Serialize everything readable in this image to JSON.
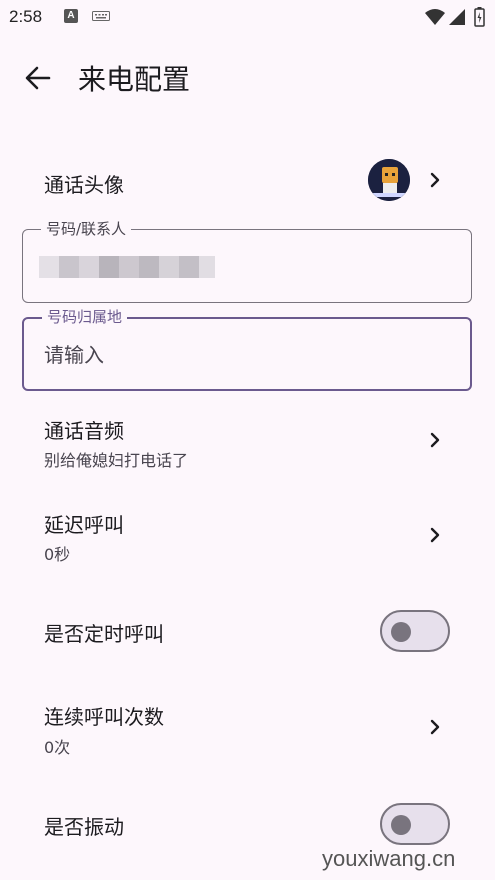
{
  "status_bar": {
    "time": "2:58",
    "a_icon": "A"
  },
  "app_bar": {
    "title": "来电配置",
    "back_icon": "arrow-left-icon"
  },
  "items": {
    "avatar_row": {
      "title": "通话头像"
    },
    "number_field": {
      "label": "号码/联系人",
      "value": ""
    },
    "region_field": {
      "label": "号码归属地",
      "placeholder": "请输入"
    },
    "audio_row": {
      "title": "通话音频",
      "subtitle": "别给俺媳妇打电话了"
    },
    "delay_row": {
      "title": "延迟呼叫",
      "subtitle": "0秒"
    },
    "timed_row": {
      "title": "是否定时呼叫",
      "toggle_on": false
    },
    "repeat_row": {
      "title": "连续呼叫次数",
      "subtitle": "0次"
    },
    "vibrate_row": {
      "title": "是否振动",
      "toggle_on": false
    }
  },
  "colors": {
    "background": "#fdf7fc",
    "accent": "#6b5a8e",
    "outline": "#79747e"
  },
  "watermark": "youxiwang.cn"
}
